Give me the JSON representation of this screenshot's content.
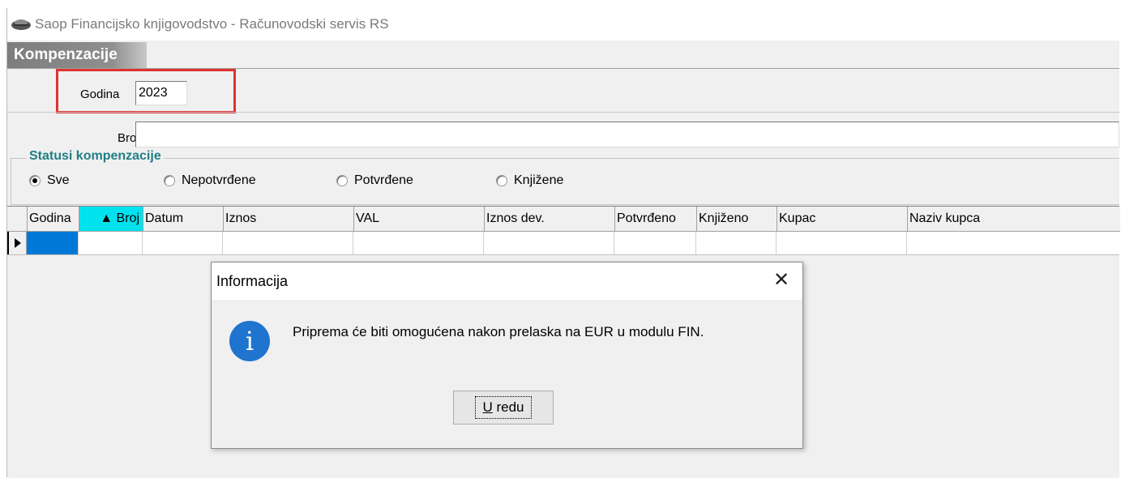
{
  "window": {
    "title": "Saop Financijsko knjigovodstvo - Računovodski servis RS"
  },
  "form": {
    "header": "Kompenzacije",
    "godina_label": "Godina",
    "godina_value": "2023",
    "broj_label": "Broj",
    "broj_value": ""
  },
  "status_group": {
    "title": "Statusi kompenzacije",
    "options": [
      {
        "label": "Sve",
        "selected": true
      },
      {
        "label": "Nepotvrđene",
        "selected": false
      },
      {
        "label": "Potvrđene",
        "selected": false
      },
      {
        "label": "Knjižene",
        "selected": false
      }
    ]
  },
  "grid": {
    "columns": [
      {
        "label": "Godina"
      },
      {
        "label": "▲ Broj",
        "sorted": true
      },
      {
        "label": "Datum"
      },
      {
        "label": "Iznos"
      },
      {
        "label": "VAL"
      },
      {
        "label": "Iznos dev."
      },
      {
        "label": "Potvrđeno"
      },
      {
        "label": "Knjiženo"
      },
      {
        "label": "Kupac"
      },
      {
        "label": "Naziv kupca"
      }
    ]
  },
  "dialog": {
    "title": "Informacija",
    "message": "Priprema će biti omogućena nakon prelaska na EUR u modulu FIN.",
    "ok_label_underlined": "U",
    "ok_label_rest": " redu",
    "icon": "info-icon",
    "icon_color": "#1e74cf"
  },
  "colors": {
    "highlight": "#e0322f",
    "group_title": "#1f7f86",
    "sorted_column": "#00e3ef",
    "active_cell": "#0078d7"
  }
}
